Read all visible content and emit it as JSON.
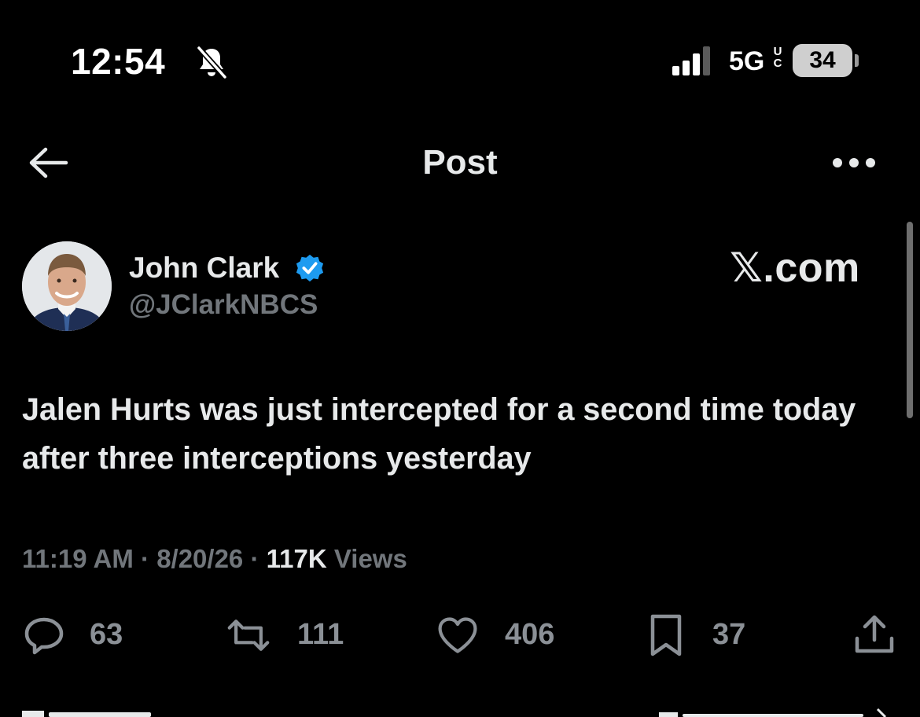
{
  "status_bar": {
    "time": "12:54",
    "network": "5G",
    "network_sup": "U C",
    "battery": "34"
  },
  "nav": {
    "title": "Post"
  },
  "post": {
    "author_name": "John Clark",
    "author_handle": "@JClarkNBCS",
    "watermark": "𝕏.com",
    "text": "Jalen Hurts was just intercepted for a second time today after three interceptions yesterday",
    "time": "11:19 AM",
    "date": "8/20/26",
    "views_count": "117K",
    "views_label": "Views",
    "separator": " · "
  },
  "actions": {
    "replies": "63",
    "reposts": "111",
    "likes": "406",
    "bookmarks": "37"
  },
  "colors": {
    "background": "#000000",
    "text": "#e7e9ea",
    "secondary": "#71767b",
    "verified": "#1d9bf0"
  }
}
